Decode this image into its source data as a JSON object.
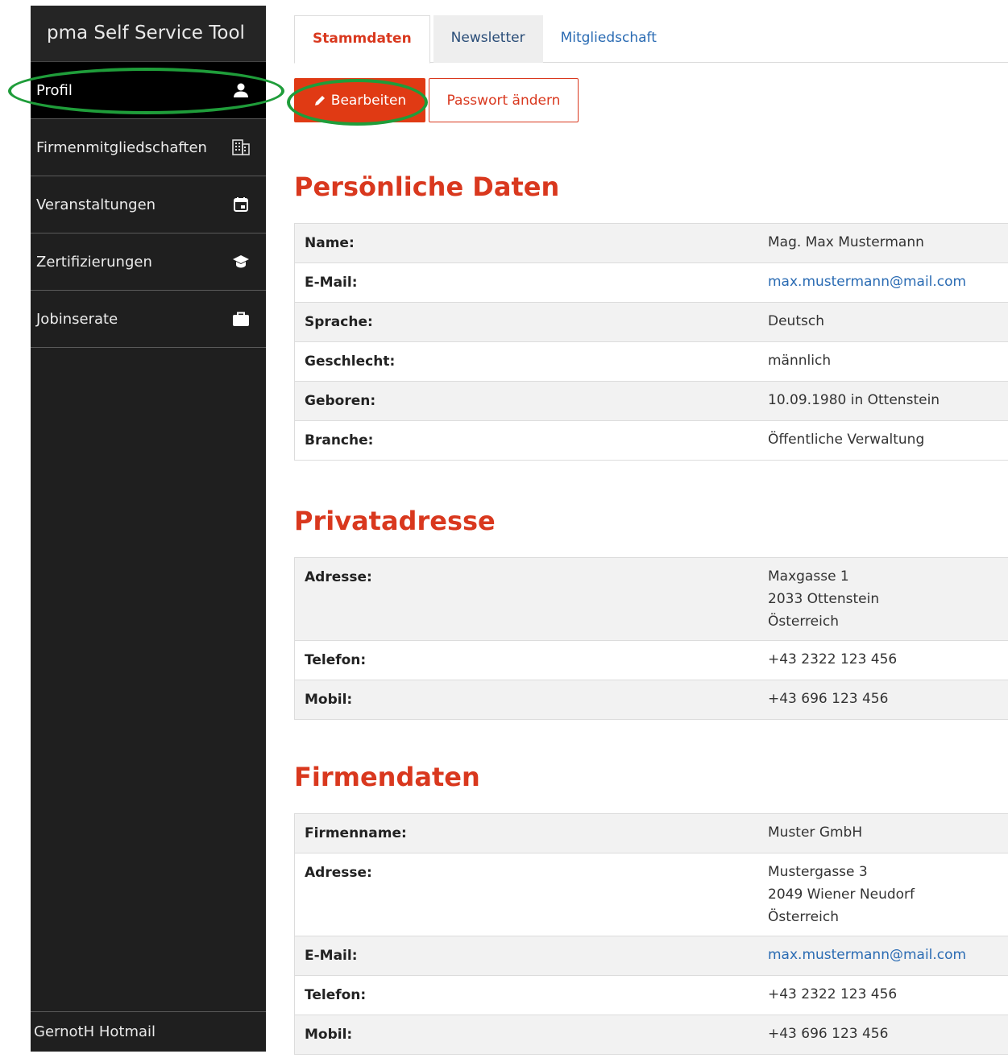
{
  "app": {
    "title": "pma Self Service Tool"
  },
  "sidebar": {
    "items": [
      {
        "label": "Profil",
        "icon": "person-icon",
        "active": true
      },
      {
        "label": "Firmenmitgliedschaften",
        "icon": "building-icon"
      },
      {
        "label": "Veranstaltungen",
        "icon": "calendar-icon"
      },
      {
        "label": "Zertifizierungen",
        "icon": "graduation-cap-icon"
      },
      {
        "label": "Jobinserate",
        "icon": "briefcase-icon"
      }
    ],
    "footer_user": "GernotH Hotmail"
  },
  "tabs": [
    {
      "label": "Stammdaten",
      "active": true
    },
    {
      "label": "Newsletter"
    },
    {
      "label": "Mitgliedschaft"
    }
  ],
  "actions": {
    "edit_label": "Bearbeiten",
    "password_label": "Passwort ändern"
  },
  "sections": {
    "personal": {
      "title": "Persönliche Daten",
      "rows": [
        {
          "label": "Name:",
          "value": "Mag. Max Mustermann"
        },
        {
          "label": "E-Mail:",
          "value": "max.mustermann@mail.com"
        },
        {
          "label": "Sprache:",
          "value": "Deutsch"
        },
        {
          "label": "Geschlecht:",
          "value": "männlich"
        },
        {
          "label": "Geboren:",
          "value": "10.09.1980 in Ottenstein"
        },
        {
          "label": "Branche:",
          "value": "Öffentliche Verwaltung"
        }
      ]
    },
    "private": {
      "title": "Privatadresse",
      "rows": [
        {
          "label": "Adresse:",
          "lines": [
            "Maxgasse 1",
            "2033 Ottenstein",
            "Österreich"
          ]
        },
        {
          "label": "Telefon:",
          "value": "+43 2322 123 456"
        },
        {
          "label": "Mobil:",
          "value": "+43 696 123 456"
        }
      ]
    },
    "company": {
      "title": "Firmendaten",
      "rows": [
        {
          "label": "Firmenname:",
          "value": "Muster GmbH"
        },
        {
          "label": "Adresse:",
          "lines": [
            "Mustergasse 3",
            "2049 Wiener Neudorf",
            "Österreich"
          ]
        },
        {
          "label": "E-Mail:",
          "value": "max.mustermann@mail.com"
        },
        {
          "label": "Telefon:",
          "value": "+43 2322 123 456"
        },
        {
          "label": "Mobil:",
          "value": "+43 696 123 456"
        }
      ]
    }
  },
  "colors": {
    "accent": "#d9381e",
    "sidebar_bg": "#1f1f1f",
    "link": "#2a6bb3",
    "annotation": "#1f9d3a"
  }
}
